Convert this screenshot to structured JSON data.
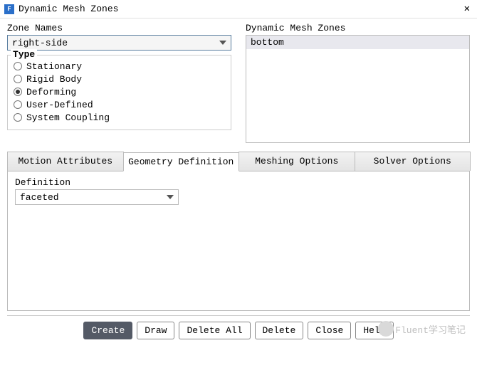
{
  "window": {
    "icon_letter": "F",
    "title": "Dynamic Mesh Zones",
    "close": "✕"
  },
  "zone_names": {
    "label": "Zone Names",
    "value": "right-side"
  },
  "dmz_list": {
    "label": "Dynamic Mesh Zones",
    "items": [
      "bottom"
    ]
  },
  "type": {
    "legend": "Type",
    "options": [
      {
        "label": "Stationary",
        "checked": false
      },
      {
        "label": "Rigid Body",
        "checked": false
      },
      {
        "label": "Deforming",
        "checked": true
      },
      {
        "label": "User-Defined",
        "checked": false
      },
      {
        "label": "System Coupling",
        "checked": false
      }
    ]
  },
  "tabs": {
    "items": [
      {
        "label": "Motion Attributes",
        "active": false
      },
      {
        "label": "Geometry Definition",
        "active": true
      },
      {
        "label": "Meshing Options",
        "active": false
      },
      {
        "label": "Solver Options",
        "active": false
      }
    ]
  },
  "definition": {
    "label": "Definition",
    "value": "faceted"
  },
  "buttons": {
    "create": "Create",
    "draw": "Draw",
    "delete_all": "Delete All",
    "delete": "Delete",
    "close": "Close",
    "help": "Help"
  },
  "watermark": "Fluent学习笔记"
}
